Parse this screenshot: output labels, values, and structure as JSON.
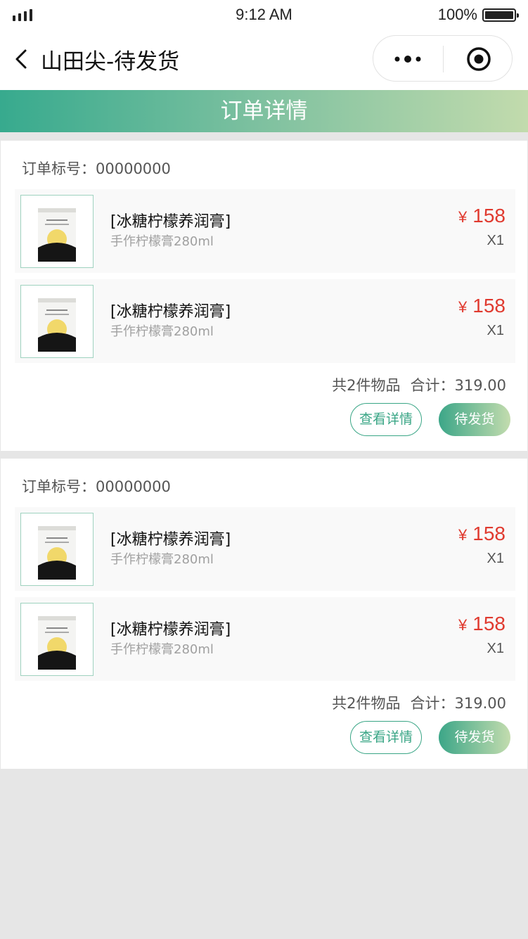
{
  "status_bar": {
    "time": "9:12 AM",
    "battery": "100%",
    "signal_icon": "signal-bars-icon",
    "battery_icon": "battery-full-icon"
  },
  "nav": {
    "title": "山田尖-待发货",
    "back_icon": "chevron-left-icon",
    "more_icon": "more-dots-icon",
    "close_icon": "target-circle-icon"
  },
  "banner": {
    "title": "订单详情"
  },
  "colors": {
    "accent": "#3aa686",
    "price": "#e03a2f",
    "background": "#e6e6e6"
  },
  "orders": [
    {
      "order_label": "订单标号：00000000",
      "items": [
        {
          "name": "[冰糖柠檬养润膏]",
          "spec": "手作柠檬膏280ml",
          "currency": "¥",
          "price": "158",
          "qty": "X1"
        },
        {
          "name": "[冰糖柠檬养润膏]",
          "spec": "手作柠檬膏280ml",
          "currency": "¥",
          "price": "158",
          "qty": "X1"
        }
      ],
      "count_text": "共2件物品",
      "total_text": "合计：319.00",
      "detail_button": "查看详情",
      "status_button": "待发货"
    },
    {
      "order_label": "订单标号：00000000",
      "items": [
        {
          "name": "[冰糖柠檬养润膏]",
          "spec": "手作柠檬膏280ml",
          "currency": "¥",
          "price": "158",
          "qty": "X1"
        },
        {
          "name": "[冰糖柠檬养润膏]",
          "spec": "手作柠檬膏280ml",
          "currency": "¥",
          "price": "158",
          "qty": "X1"
        }
      ],
      "count_text": "共2件物品",
      "total_text": "合计：319.00",
      "detail_button": "查看详情",
      "status_button": "待发货"
    }
  ]
}
